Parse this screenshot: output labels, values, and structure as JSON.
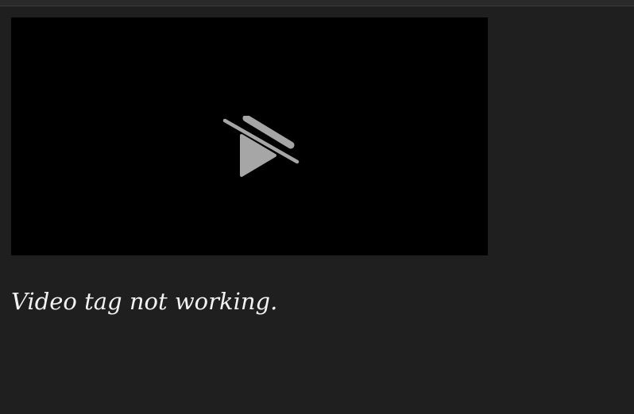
{
  "video": {
    "icon": "video-unavailable-icon",
    "background_color": "#000000",
    "icon_color": "#a6a6a6"
  },
  "caption": {
    "text": "Video tag not working."
  },
  "colors": {
    "page_background": "#1f1f1f",
    "caption_text": "#f2f2f2"
  }
}
